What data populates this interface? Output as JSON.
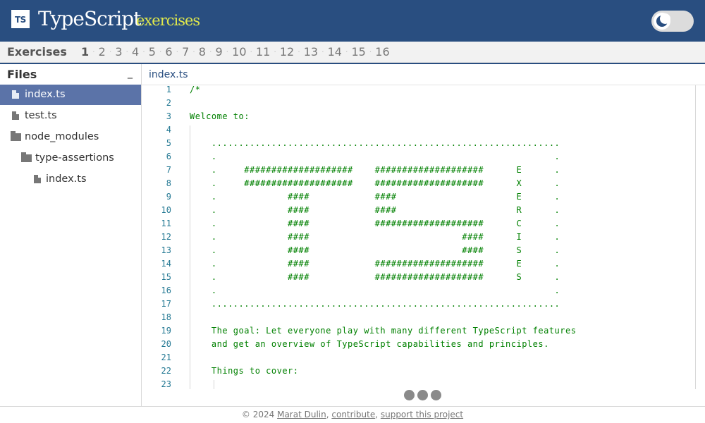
{
  "header": {
    "logo_text": "TS",
    "brand": "TypeScript",
    "brand_sub": "exercises",
    "theme_toggle_icon": "moon-icon"
  },
  "exercises": {
    "title": "Exercises",
    "current": "1",
    "items": [
      "1",
      "2",
      "3",
      "4",
      "5",
      "6",
      "7",
      "8",
      "9",
      "10",
      "11",
      "12",
      "13",
      "14",
      "15",
      "16"
    ],
    "separator": "·"
  },
  "files": {
    "title": "Files",
    "collapse": "_",
    "items": [
      {
        "label": "index.ts",
        "icon": "file-icon",
        "active": true
      },
      {
        "label": "test.ts",
        "icon": "file-icon",
        "active": false
      },
      {
        "label": "node_modules",
        "icon": "folder-icon",
        "active": false
      },
      {
        "label": "type-assertions",
        "icon": "folder-icon",
        "active": false
      },
      {
        "label": "index.ts",
        "icon": "file-icon",
        "active": false
      }
    ]
  },
  "editor": {
    "tab": "index.ts",
    "line_numbers": [
      "1",
      "2",
      "3",
      "4",
      "5",
      "6",
      "7",
      "8",
      "9",
      "10",
      "11",
      "12",
      "13",
      "14",
      "15",
      "16",
      "17",
      "18",
      "19",
      "20",
      "21",
      "22",
      "23"
    ],
    "lines": [
      "/*",
      "",
      "Welcome to:",
      "",
      "    ................................................................",
      "    .                                                              .",
      "    .     ####################    ####################      E      .",
      "    .     ####################    ####################      X      .",
      "    .             ####            ####                      E      .",
      "    .             ####            ####                      R      .",
      "    .             ####            ####################      C      .",
      "    .             ####                            ####      I      .",
      "    .             ####                            ####      S      .",
      "    .             ####            ####################      E      .",
      "    .             ####            ####################      S      .",
      "    .                                                              .",
      "    ................................................................",
      "",
      "    The goal: Let everyone play with many different TypeScript features",
      "    and get an overview of TypeScript capabilities and principles.",
      "",
      "    Things to cover:",
      ""
    ]
  },
  "footer": {
    "copyright": "© 2024",
    "author": "Marat Dulin",
    "contribute": "contribute",
    "support": "support this project"
  },
  "colors": {
    "header_bg": "#294e80",
    "brand_sub": "#e0e84b",
    "active_file_bg": "#5b73a8",
    "code_comment": "#008000",
    "line_number": "#237893"
  }
}
